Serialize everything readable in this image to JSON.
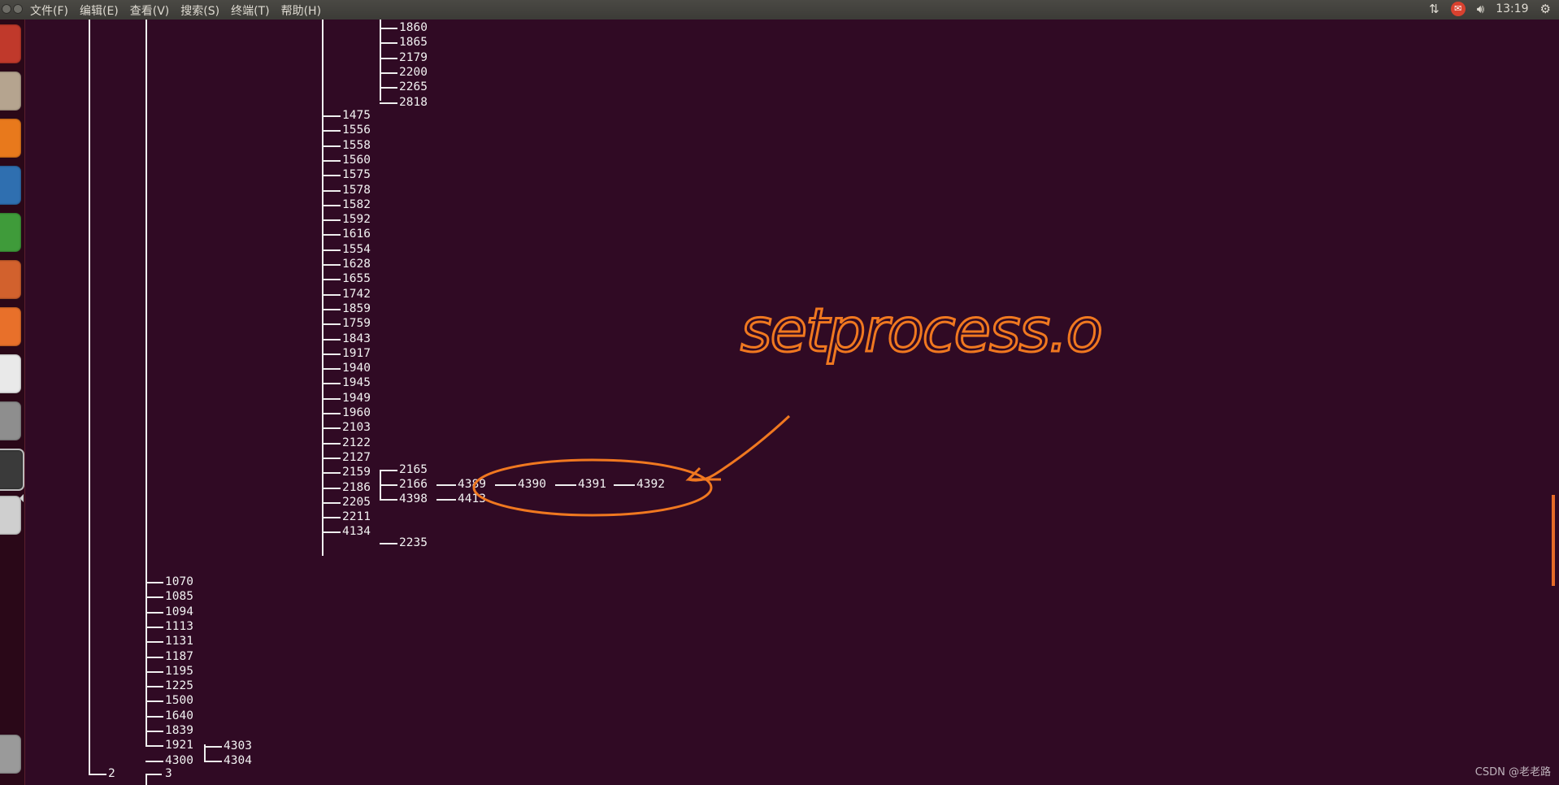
{
  "menubar": {
    "items": [
      "文件(F)",
      "编辑(E)",
      "查看(V)",
      "搜索(S)",
      "终端(T)",
      "帮助(H)"
    ]
  },
  "tray": {
    "network_icon": "network-updown-icon",
    "messaging_icon": "chat-badge-icon",
    "sound_icon": "speaker-icon",
    "time": "13:19",
    "settings_icon": "gear-icon"
  },
  "launcher": {
    "icons": [
      "ubuntu-dash-icon",
      "files-icon",
      "firefox-icon",
      "writer-icon",
      "calc-icon",
      "impress-icon",
      "software-center-icon",
      "amazon-icon",
      "system-settings-icon",
      "terminal-icon",
      "dvd-icon",
      "trash-icon"
    ]
  },
  "pstree": {
    "col4_top": [
      "1860",
      "1865",
      "2179",
      "2200",
      "2265",
      "2818"
    ],
    "col3": [
      "1475",
      "1556",
      "1558",
      "1560",
      "1575",
      "1578",
      "1582",
      "1592",
      "1616",
      "1554",
      "1628",
      "1655",
      "1742",
      "1859",
      "1759",
      "1843",
      "1917",
      "1940",
      "1945",
      "1949",
      "1960",
      "2103",
      "2122",
      "2127",
      "2159",
      "2186",
      "2205",
      "2211",
      "4134"
    ],
    "col4_2159": [
      "2165",
      "2166",
      "4398"
    ],
    "chain_2166": [
      "4389",
      "4390",
      "4391",
      "4392"
    ],
    "child_4398": "4413",
    "child_2211": "2235",
    "col2": [
      "1070",
      "1085",
      "1094",
      "1113",
      "1131",
      "1187",
      "1195",
      "1225",
      "1500",
      "1640",
      "1839",
      "1921",
      "4300"
    ],
    "col3_4300": [
      "4303",
      "4304"
    ],
    "root_child": "2",
    "root_child2": "3"
  },
  "annotation": {
    "text": "setprocess.o",
    "color": "#f07820"
  },
  "watermark": "CSDN @老老路"
}
